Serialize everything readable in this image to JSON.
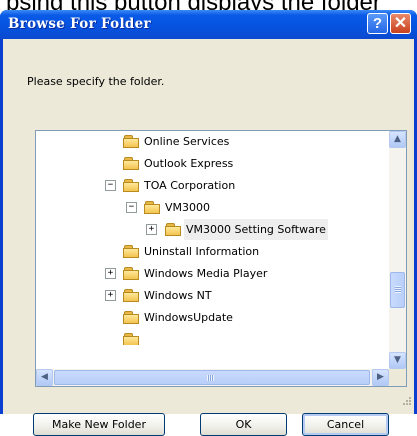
{
  "background_text": "psing this button displays the folder",
  "dialog": {
    "title": "Browse For Folder",
    "help_glyph": "?",
    "close_glyph": "✕",
    "prompt": "Please specify the folder."
  },
  "tree": {
    "items": [
      {
        "label": "Online Services",
        "expander": ""
      },
      {
        "label": "Outlook Express",
        "expander": ""
      },
      {
        "label": "TOA Corporation",
        "expander": "−"
      },
      {
        "label": "VM3000",
        "expander": "−"
      },
      {
        "label": "VM3000 Setting Software",
        "expander": "+",
        "selected": true
      },
      {
        "label": "Uninstall Information",
        "expander": ""
      },
      {
        "label": "Windows Media Player",
        "expander": "+"
      },
      {
        "label": "Windows NT",
        "expander": "+"
      },
      {
        "label": "WindowsUpdate",
        "expander": ""
      }
    ]
  },
  "buttons": {
    "make_new_folder": "Make New Folder",
    "ok": "OK",
    "cancel": "Cancel"
  },
  "scroll_glyphs": {
    "up": "▲",
    "down": "▼",
    "left": "◀",
    "right": "▶"
  },
  "colors": {
    "titlebar": "#0553e0",
    "close": "#c8401e",
    "dialog": "#ece9d8"
  }
}
